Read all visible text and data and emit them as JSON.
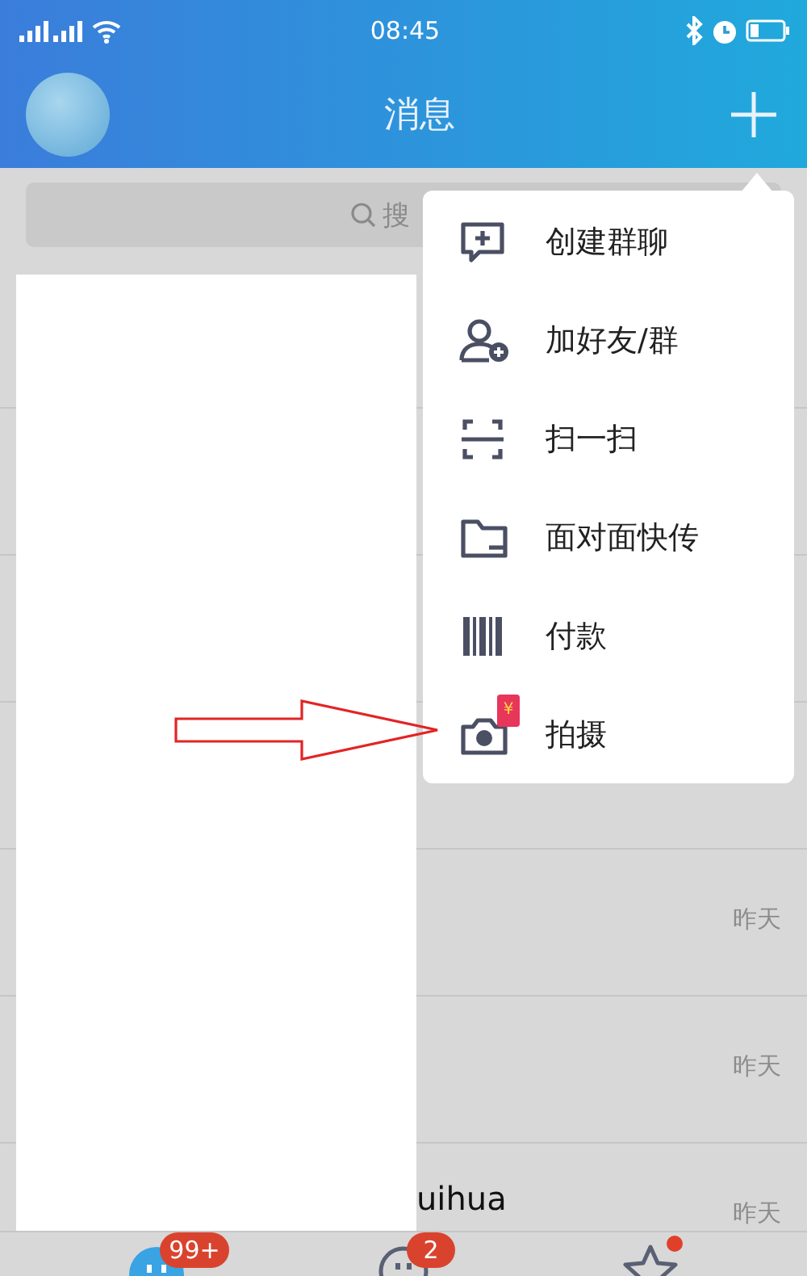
{
  "status_bar": {
    "time": "08:45"
  },
  "nav": {
    "title": "消息"
  },
  "search": {
    "placeholder": "搜"
  },
  "conversations": [
    {
      "time": "昨天"
    },
    {
      "time": "昨天"
    },
    {
      "name": "uihua",
      "time": "昨天"
    }
  ],
  "menu": {
    "items": [
      {
        "label": "创建群聊"
      },
      {
        "label": "加好友/群"
      },
      {
        "label": "扫一扫"
      },
      {
        "label": "面对面快传"
      },
      {
        "label": "付款"
      },
      {
        "label": "拍摄",
        "badge": "¥"
      }
    ]
  },
  "tab_bar": {
    "tabs": [
      {
        "selected": true,
        "badge": "99+",
        "unread_dot": false
      },
      {
        "selected": false,
        "badge": "2",
        "unread_dot": false
      },
      {
        "selected": false,
        "unread_dot": true
      }
    ]
  }
}
